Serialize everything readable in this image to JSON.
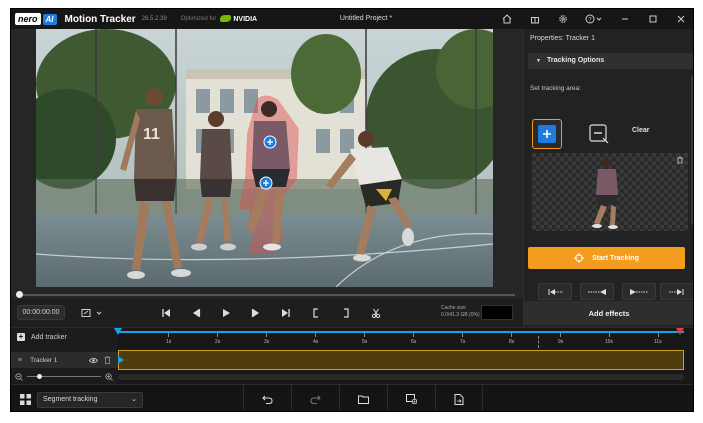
{
  "titlebar": {
    "logo_nero": "nero",
    "logo_ai": "AI",
    "app_name": "Motion Tracker",
    "version": "26.5.2.39",
    "optimized_for": "Optimized for",
    "gpu_brand": "NVIDIA",
    "project_title": "Untitled Project *",
    "icons": [
      "home-icon",
      "gift-icon",
      "gear-icon",
      "help-icon",
      "minimize-icon",
      "maximize-icon",
      "close-icon"
    ]
  },
  "player": {
    "timecode": "00:00:00:00",
    "cache_label": "Cache size",
    "cache_value": "0.0/41.3 GB (0%)",
    "progress": 0
  },
  "timeline": {
    "add_tracker_label": "Add tracker",
    "tracker_name": "Tracker 1",
    "ticks": [
      "1s",
      "2s",
      "3s",
      "4s",
      "5s",
      "6s",
      "7s",
      "8s",
      "9s",
      "10s",
      "11s"
    ]
  },
  "bottombar": {
    "mode_select": "Segment tracking"
  },
  "panel": {
    "title": "Properties: Tracker 1",
    "section_title": "Tracking Options",
    "set_area_label": "Set tracking area:",
    "clear_label": "Clear",
    "start_label": "Start Tracking",
    "add_effects_label": "Add effects"
  },
  "colors": {
    "accent_orange": "#f39c1f",
    "accent_blue": "#1aa1e6",
    "mask_red": "#e43a3a",
    "track_gold": "#c9a227"
  }
}
